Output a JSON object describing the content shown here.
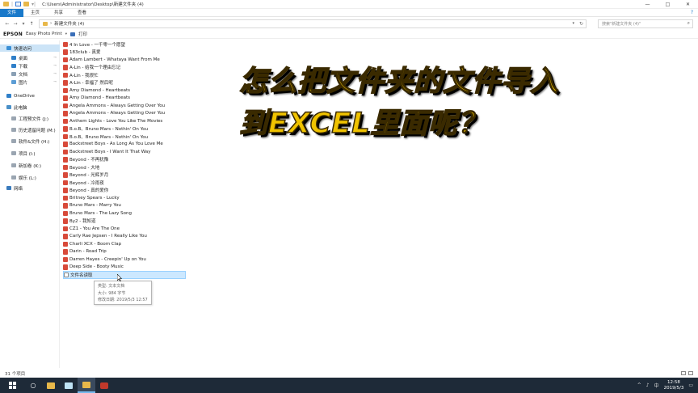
{
  "window": {
    "title_path": "C:\\Users\\Administrator\\Desktop\\新建文件夹 (4)",
    "controls": [
      "—",
      "□",
      "✕"
    ]
  },
  "ribbon": {
    "tabs": [
      "文件",
      "主页",
      "共享",
      "查看"
    ],
    "help": "?"
  },
  "address": {
    "crumb": "新建文件夹 (4)",
    "search_placeholder": "搜索\"新建文件夹 (4)\""
  },
  "epson": {
    "brand": "EPSON",
    "app": "Easy Photo Print",
    "print": "打印"
  },
  "sidebar": {
    "items": [
      {
        "label": "快速访问",
        "icon": "star-icon",
        "pinned": false,
        "selected": true
      },
      {
        "label": "桌面",
        "icon": "desktop-icon",
        "pinned": true
      },
      {
        "label": "下载",
        "icon": "download-icon",
        "pinned": true
      },
      {
        "label": "文档",
        "icon": "document-icon",
        "pinned": true
      },
      {
        "label": "图片",
        "icon": "picture-icon",
        "pinned": true
      },
      {
        "label": "OneDrive",
        "icon": "cloud-icon",
        "pinned": false
      },
      {
        "label": "此电脑",
        "icon": "computer-icon",
        "pinned": false
      },
      {
        "label": "工程预文件 (J:)",
        "icon": "drive-icon",
        "pinned": false
      },
      {
        "label": "历史遗留问题 (M:)",
        "icon": "drive-icon",
        "pinned": false
      },
      {
        "label": "软件&文件 (H:)",
        "icon": "drive-icon",
        "pinned": false
      },
      {
        "label": "项目 (I:)",
        "icon": "drive-icon",
        "pinned": false
      },
      {
        "label": "新加卷 (K:)",
        "icon": "drive-icon",
        "pinned": false
      },
      {
        "label": "娱乐 (L:)",
        "icon": "drive-icon",
        "pinned": false
      },
      {
        "label": "网络",
        "icon": "network-icon",
        "pinned": false
      }
    ]
  },
  "files": [
    {
      "name": "4 In Love - 一千零一个愿望",
      "type": "mp3"
    },
    {
      "name": "183club - 真爱",
      "type": "mp3"
    },
    {
      "name": "Adam Lambert - Whataya Want From Me",
      "type": "mp3"
    },
    {
      "name": "A-Lin - 给我一个理由忘记",
      "type": "mp3"
    },
    {
      "name": "A-Lin - 我很忙",
      "type": "mp3"
    },
    {
      "name": "A-Lin - 幸福了 然后呢",
      "type": "mp3"
    },
    {
      "name": "Amy Diamond - Heartbeats",
      "type": "mp3"
    },
    {
      "name": "Amy Diamond - Heartbeats",
      "type": "mp3"
    },
    {
      "name": "Angela Ammons - Always Getting Over You",
      "type": "mp3"
    },
    {
      "name": "Angela Ammons - Always Getting Over You",
      "type": "mp3"
    },
    {
      "name": "Anthem Lights - Love You Like The Movies",
      "type": "mp3"
    },
    {
      "name": "B.o.B、Bruno Mars - Nothin' On You",
      "type": "mp3"
    },
    {
      "name": "B.o.B、Bruno Mars - Nothin' On You",
      "type": "mp3"
    },
    {
      "name": "Backstreet Boys - As Long As You Love Me",
      "type": "mp3"
    },
    {
      "name": "Backstreet Boys - I Want It That Way",
      "type": "mp3"
    },
    {
      "name": "Beyond - 不再犹豫",
      "type": "mp3"
    },
    {
      "name": "Beyond - 大地",
      "type": "mp3"
    },
    {
      "name": "Beyond - 光辉岁月",
      "type": "mp3"
    },
    {
      "name": "Beyond - 冷雨夜",
      "type": "mp3"
    },
    {
      "name": "Beyond - 真的爱你",
      "type": "mp3"
    },
    {
      "name": "Britney Spears - Lucky",
      "type": "mp3"
    },
    {
      "name": "Bruno Mars - Marry You",
      "type": "mp3"
    },
    {
      "name": "Bruno Mars - The Lazy Song",
      "type": "mp3"
    },
    {
      "name": "By2 - 我知道",
      "type": "mp3"
    },
    {
      "name": "CZ1 - You Are The One",
      "type": "mp3"
    },
    {
      "name": "Carly Rae Jepsen - I Really Like You",
      "type": "mp3"
    },
    {
      "name": "Charli XCX - Boom Clap",
      "type": "mp3"
    },
    {
      "name": "Darin - Road Trip",
      "type": "mp3"
    },
    {
      "name": "Darren Hayes - Creepin' Up on You",
      "type": "mp3"
    },
    {
      "name": "Deep Side - Booty Music",
      "type": "mp3"
    },
    {
      "name": "文件名读取",
      "type": "txt",
      "selected": true
    }
  ],
  "tooltip": {
    "type_line": "类型: 文本文档",
    "size_line": "大小: 984 字节",
    "date_line": "修改日期: 2019/5/3 12:57"
  },
  "overlay": {
    "line1": "怎么把文件夹的文件导入",
    "line2": "到EXCEL里面呢？"
  },
  "status": {
    "count": "31 个项目"
  },
  "taskbar": {
    "time": "12:58",
    "date": "2019/5/3",
    "tray_symbols": [
      "^",
      "♪",
      "中"
    ]
  },
  "colors": {
    "file_tab": "#1979ca",
    "selection": "#cce8ff",
    "headline": "#f0c300",
    "taskbar": "#1e2a38"
  }
}
